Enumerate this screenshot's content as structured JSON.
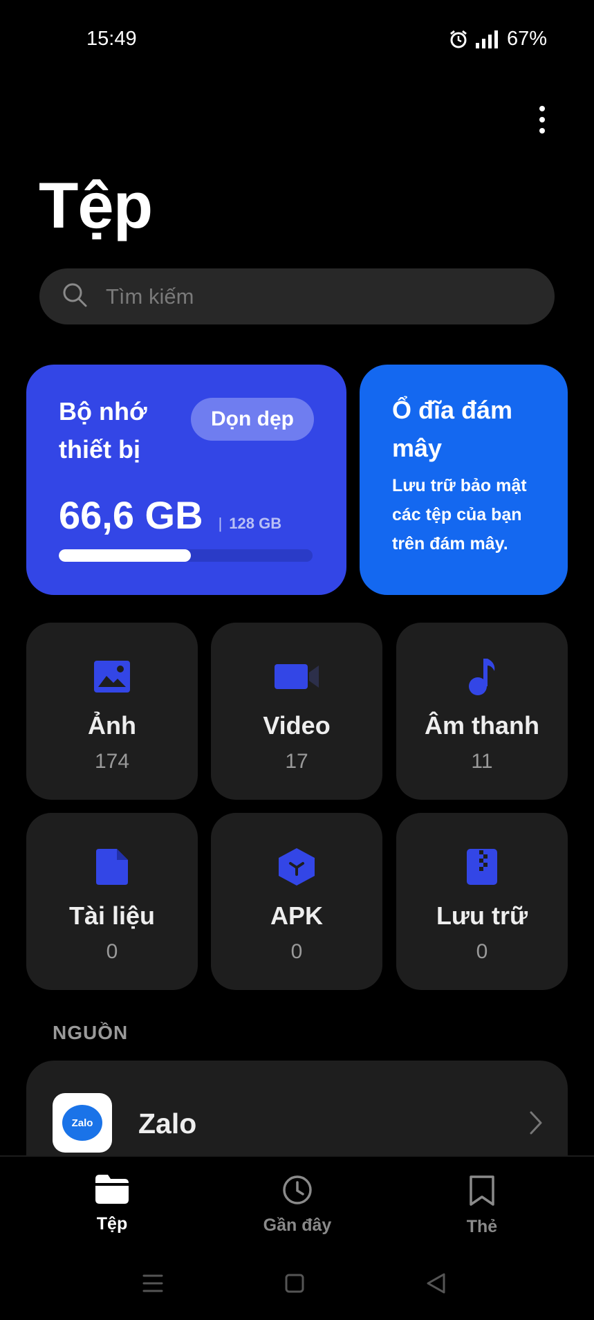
{
  "status_bar": {
    "time": "15:49",
    "battery": "67%",
    "icons": [
      "alarm-icon",
      "signal-icon"
    ]
  },
  "header": {
    "title": "Tệp",
    "menu_icon": "more-vertical-icon"
  },
  "search": {
    "placeholder": "Tìm kiếm",
    "value": "",
    "icon": "search-icon"
  },
  "storage": {
    "title": "Bộ nhớ thiết bị",
    "clean_label": "Dọn dẹp",
    "used": "66,6 GB",
    "separator": "|",
    "total": "128 GB",
    "used_fraction": 0.52,
    "color": "#3346e6"
  },
  "cloud": {
    "title": "Ổ đĩa đám mây",
    "description": "Lưu trữ bảo mật các tệp của bạn trên đám mây.",
    "color": "#1468f0"
  },
  "categories": [
    {
      "label": "Ảnh",
      "count": "174",
      "icon": "image-icon"
    },
    {
      "label": "Video",
      "count": "17",
      "icon": "video-icon"
    },
    {
      "label": "Âm thanh",
      "count": "11",
      "icon": "music-note-icon"
    },
    {
      "label": "Tài liệu",
      "count": "0",
      "icon": "document-icon"
    },
    {
      "label": "APK",
      "count": "0",
      "icon": "apk-icon"
    },
    {
      "label": "Lưu trữ",
      "count": "0",
      "icon": "archive-icon"
    }
  ],
  "sources": {
    "section_label": "NGUỒN",
    "items": [
      {
        "name": "Zalo",
        "logo_text": "Zalo",
        "icon": "zalo-logo"
      }
    ]
  },
  "bottom_nav": {
    "items": [
      {
        "label": "Tệp",
        "icon": "folder-icon",
        "active": true
      },
      {
        "label": "Gần đây",
        "icon": "clock-icon",
        "active": false
      },
      {
        "label": "Thẻ",
        "icon": "bookmark-icon",
        "active": false
      }
    ]
  },
  "accent_color": "#3346e6"
}
